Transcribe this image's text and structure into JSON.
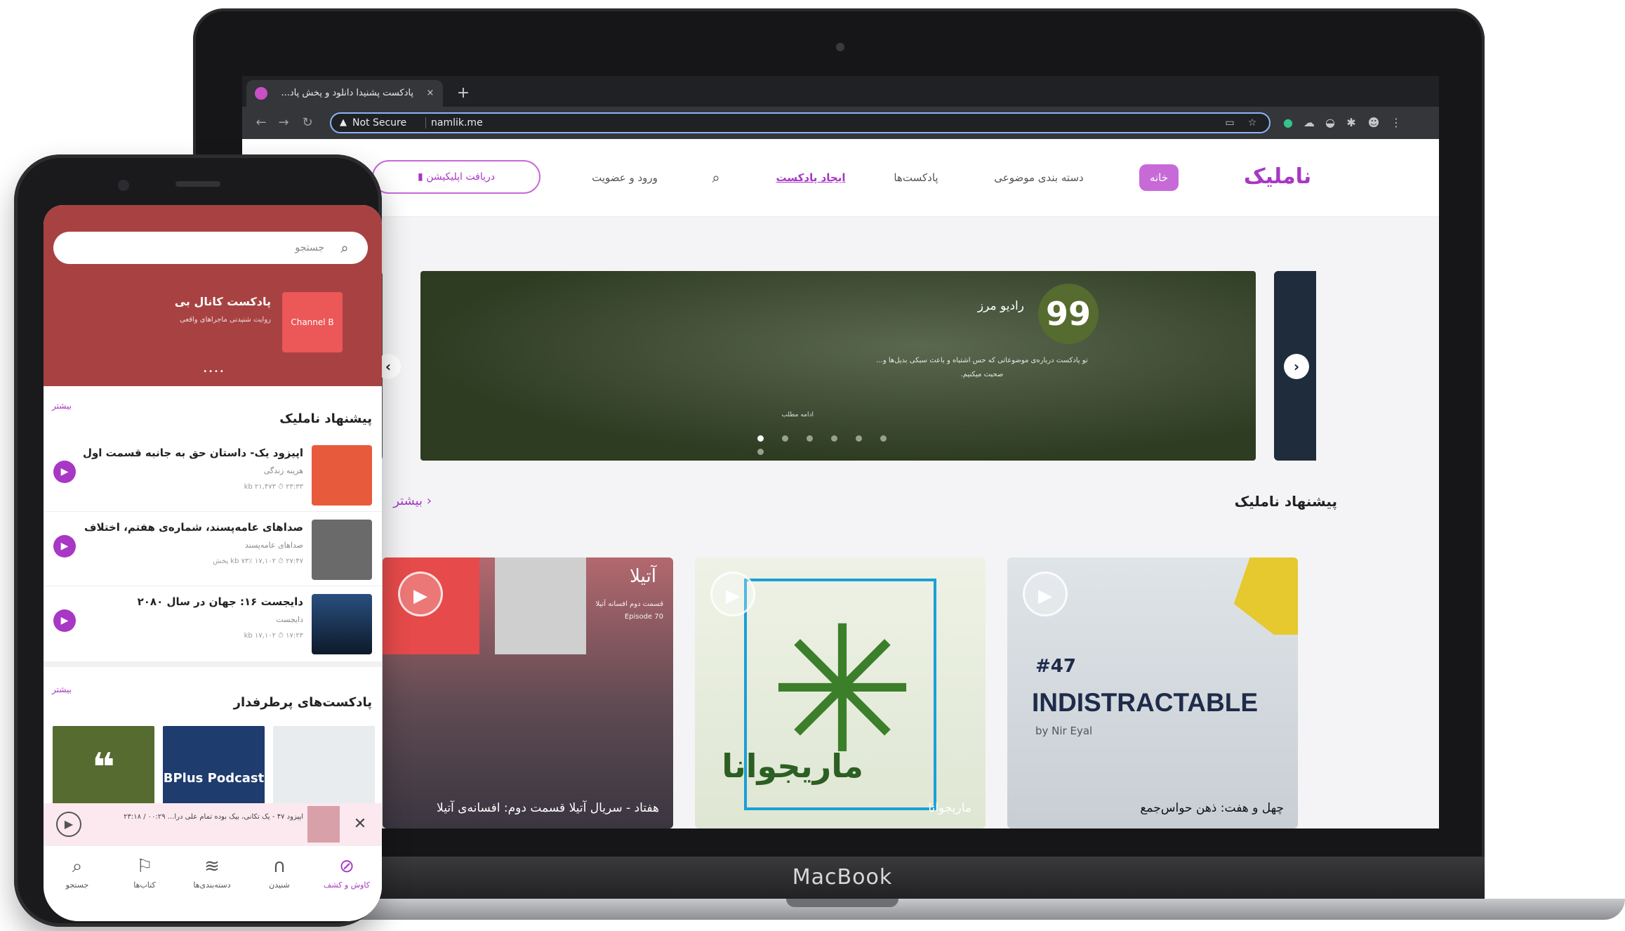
{
  "laptop": {
    "brand": "MacBook",
    "browser": {
      "tab_title": "پادکست پشنیدا دانلود و پخش پاد...",
      "tab_close": "×",
      "new_tab": "+",
      "not_secure": "Not Secure",
      "url": "namlik.me",
      "warning_icon": "▲"
    },
    "site": {
      "logo": "ناملیک",
      "nav": {
        "home": "خانه",
        "categories": "دسته بندی موضوعی",
        "podcasts": "پادکست‌ها",
        "create": "ایجاد پادکست",
        "login": "ورود و عضویت",
        "get_app": "دریافت اپلیکیشن"
      },
      "slider": {
        "logo_glyph": "99",
        "title": "رادیو مرز",
        "description": "تو پادکست درباره‌ی موضوعاتی که حس اشتباه و باعث سبکی بدیل‌ها و... صحبت میکنیم.",
        "more": "ادامه مطلب",
        "dots": 7,
        "active_dot": 0
      },
      "section": {
        "title": "پیشنهاد ناملیک",
        "more": "بیشتر"
      },
      "cards": [
        {
          "caption": "چهل و هفت: ذهن حواس‌جمع",
          "number": "#47",
          "title": "INDISTRACTABLE",
          "author": "by Nir Eyal"
        },
        {
          "caption": "ماریجوانا",
          "art_text": "ماریجوانا"
        },
        {
          "caption": "هفتاد - سریال آتیلا قسمت دوم: افسانه‌ی آتیلا",
          "name": "آتیلا",
          "sub": "قسمت دوم افسانه آتیلا Episode 70"
        }
      ]
    }
  },
  "phone": {
    "search_placeholder": "جستجو",
    "hero": {
      "title": "پادکست کانال بی",
      "subtitle": "روایت شنیدنی ماجراهای واقعی",
      "logo": "Channel B"
    },
    "recommend": {
      "title": "پیشنهاد ناملیک",
      "more": "بیشتر",
      "episodes": [
        {
          "title": "اپیزود یک- داستان حق به جانبه قسمت اول",
          "sub": "هزینه زندگی",
          "meta": "۲۳:۳۳ ⏱   ۲۱,۴۷۳ kb"
        },
        {
          "title": "صداهای عامه‌پسند، شماره‌ی هفتم، اختلاف",
          "sub": "صداهای عامه‌پسند",
          "meta": "۲۷:۴۷ ⏱   ۱۷,۱۰۲ kb   ۷۳٪ پخش"
        },
        {
          "title": "دایجست ۱۶: جهان در سال ۲۰۸۰",
          "sub": "دایجست",
          "meta": "۱۷:۲۳ ⏱   ۱۷,۱۰۲ kb"
        }
      ]
    },
    "popular": {
      "title": "پادکست‌های پرطرفدار",
      "more": "بیشتر",
      "bplus": "BPlus Podcast"
    },
    "player": {
      "text": "اپیزود ۴۷ - یک تکانی، بیک بوده تمام علی درا... ۰۰:۲۹ / ۲۳:۱۸"
    },
    "tabs": [
      "جستجو",
      "کتاب‌ها",
      "دسته‌بندی‌ها",
      "شنیدن",
      "کاوش و کشف"
    ],
    "active_tab": 4
  }
}
